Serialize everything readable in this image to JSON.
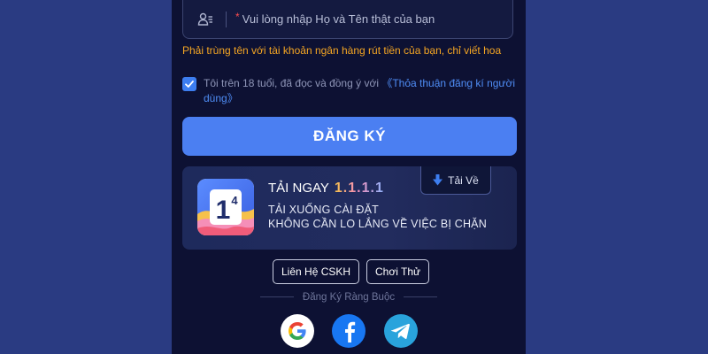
{
  "form": {
    "name_required_mark": "*",
    "name_placeholder": "Vui lòng nhập Họ và Tên thật của bạn",
    "name_value": "",
    "name_hint": "Phải trùng tên với tài khoản ngân hàng rút tiền của bạn, chỉ viết hoa",
    "agreement_checked": true,
    "agreement_text": "Tôi trên 18 tuổi, đã đọc và đồng ý với ",
    "agreement_link": "《Thỏa thuận đăng kí người dùng》",
    "register_label": "ĐĂNG KÝ"
  },
  "app_banner": {
    "logo_text": "1",
    "logo_superscript": "4",
    "title": "TẢI NGAY",
    "version": "1.1.1.1",
    "line1": "TẢI XUỐNG CÀI ĐẶT",
    "line2": "KHÔNG CẦN LO LẮNG VỀ VIỆC BỊ CHẶN",
    "download_label": "Tải Về",
    "download_icon": "arrow-down-icon"
  },
  "actions": {
    "support_label": "Liên Hệ CSKH",
    "try_label": "Chơi Thử"
  },
  "social": {
    "title": "Đăng Ký Ràng Buộc",
    "providers": [
      "google-icon",
      "facebook-icon",
      "telegram-icon"
    ]
  },
  "colors": {
    "page_background": "#2a3b82",
    "panel_background": "#0d1133",
    "primary": "#4b7ff2",
    "warning": "#f5a623",
    "link": "#4f8df5"
  }
}
